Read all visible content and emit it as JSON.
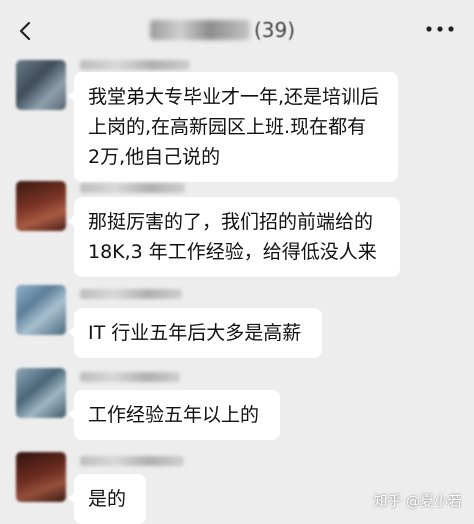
{
  "header": {
    "title_suffix": "(39)",
    "back_icon": "chevron-left-icon",
    "more_icon": "more-dots-icon"
  },
  "messages": [
    {
      "text": "我堂弟大专毕业才一年,还是培训后上岗的,在高新园区上班.现在都有 2万,他自己说的"
    },
    {
      "text": "那挺厉害的了，我们招的前端给的18K,3 年工作经验，给得低没人来"
    },
    {
      "text": "IT 行业五年后大多是高薪"
    },
    {
      "text": "工作经验五年以上的"
    },
    {
      "text": "是的"
    }
  ],
  "watermark": {
    "text": "知乎 @夏小若"
  }
}
